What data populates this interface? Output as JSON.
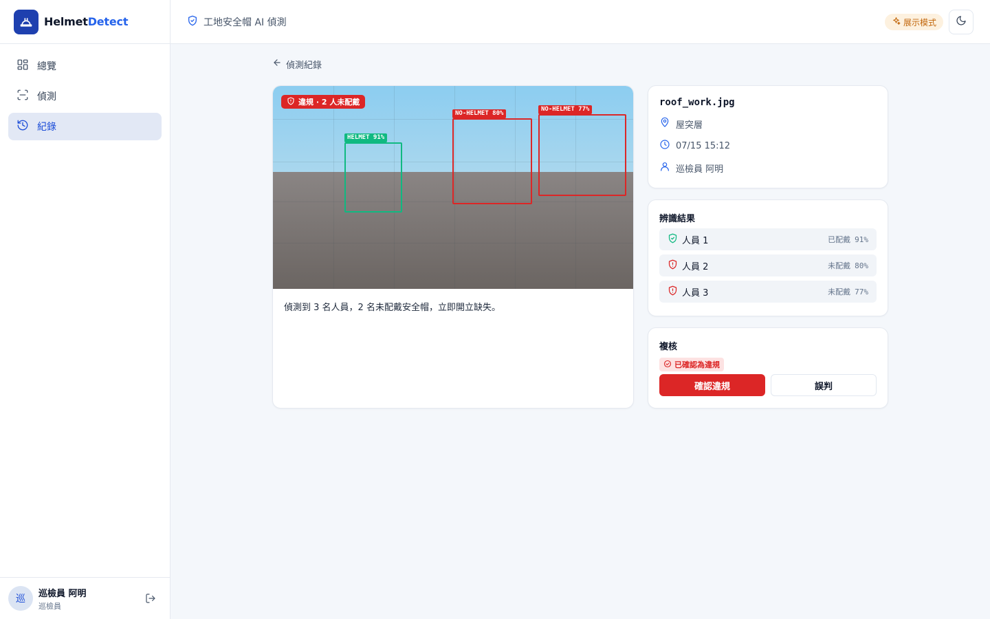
{
  "brand": {
    "name_part1": "Helmet",
    "name_part2": "Detect"
  },
  "sidebar": {
    "items": [
      {
        "label": "總覽",
        "icon": "grid-icon"
      },
      {
        "label": "偵測",
        "icon": "scan-icon"
      },
      {
        "label": "紀錄",
        "icon": "history-icon",
        "active": true
      }
    ],
    "user": {
      "avatar_char": "巡",
      "name": "巡檢員 阿明",
      "role": "巡檢員"
    }
  },
  "header": {
    "title": "工地安全帽 AI 偵測",
    "demo_badge": "展示模式"
  },
  "breadcrumb": {
    "back_label": "偵測紀錄"
  },
  "detection": {
    "violation_tag": "違規 · 2 人未配戴",
    "boxes": [
      {
        "label": "HELMET 91%",
        "status": "ok"
      },
      {
        "label": "NO-HELMET 80%",
        "status": "bad"
      },
      {
        "label": "NO-HELMET 77%",
        "status": "bad"
      }
    ],
    "summary": "偵測到 3 名人員，2 名未配戴安全帽，立即開立缺失。"
  },
  "meta": {
    "filename": "roof_work.jpg",
    "location": "屋突層",
    "time": "07/15 15:12",
    "inspector": "巡檢員 阿明"
  },
  "results": {
    "title": "辨識結果",
    "people": [
      {
        "name": "人員 1",
        "status": "已配戴",
        "confidence": "91%",
        "ok": true
      },
      {
        "name": "人員 2",
        "status": "未配戴",
        "confidence": "80%",
        "ok": false
      },
      {
        "name": "人員 3",
        "status": "未配戴",
        "confidence": "77%",
        "ok": false
      }
    ]
  },
  "review": {
    "title": "複核",
    "status": "已確認為違規",
    "confirm_label": "確認違規",
    "false_label": "誤判"
  },
  "colors": {
    "accent": "#2563eb",
    "danger": "#dc2626",
    "success": "#10b981",
    "warning": "#c2670c"
  }
}
